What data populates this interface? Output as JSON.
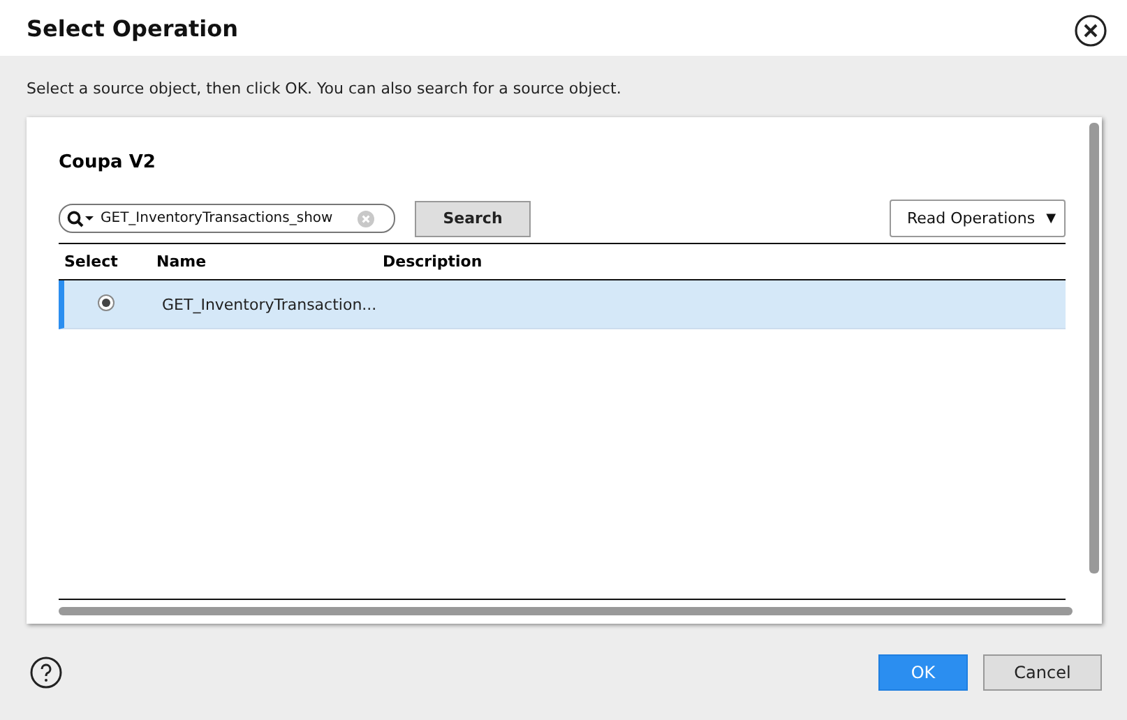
{
  "window": {
    "title": "Select Operation"
  },
  "instructions": "Select a source object, then click OK. You can also search for a source object.",
  "panel": {
    "title": "Coupa V2"
  },
  "search": {
    "value": "GET_InventoryTransactions_show",
    "button": "Search"
  },
  "filter": {
    "value": "Read Operations",
    "arrow": "▼"
  },
  "table": {
    "columns": [
      "Select",
      "Name",
      "Description"
    ],
    "rows": [
      {
        "name": "GET_InventoryTransaction...",
        "description": "",
        "selected": true
      }
    ]
  },
  "buttons": {
    "ok": "OK",
    "cancel": "Cancel"
  }
}
